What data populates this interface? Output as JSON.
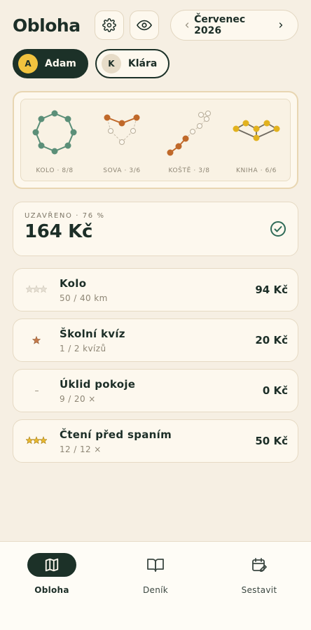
{
  "app": {
    "title": "Obloha"
  },
  "header": {
    "month": "Červenec 2026"
  },
  "users": [
    {
      "initial": "A",
      "name": "Adam",
      "active": true
    },
    {
      "initial": "K",
      "name": "Klára",
      "active": false
    }
  ],
  "constellations": [
    {
      "label": "KOLO · 8/8",
      "color": "#5b8f78"
    },
    {
      "label": "SOVA · 3/6",
      "color": "#c0692a"
    },
    {
      "label": "KOŠTĚ · 3/8",
      "color": "#c0692a"
    },
    {
      "label": "KNIHA · 6/6",
      "color": "#e2b21f"
    }
  ],
  "summary": {
    "label": "UZAVŘENO · 76 %",
    "value": "164 Kč"
  },
  "goals": [
    {
      "name": "Kolo",
      "progress": "50 / 40 km",
      "amount": "94 Kč",
      "stars": 3,
      "star_style": "faded"
    },
    {
      "name": "Školní kvíz",
      "progress": "1 / 2 kvízů",
      "amount": "20 Kč",
      "stars": 1,
      "star_style": "bronze"
    },
    {
      "name": "Úklid pokoje",
      "progress": "9 / 20 ×",
      "amount": "0 Kč",
      "stars": 0,
      "star_style": "none"
    },
    {
      "name": "Čtení před spaním",
      "progress": "12 / 12 ×",
      "amount": "50 Kč",
      "stars": 3,
      "star_style": "gold"
    }
  ],
  "nav": [
    {
      "label": "Obloha",
      "icon": "map-icon",
      "active": true
    },
    {
      "label": "Deník",
      "icon": "book-icon",
      "active": false
    },
    {
      "label": "Sestavit",
      "icon": "calendar-edit-icon",
      "active": false
    }
  ],
  "colors": {
    "background": "#f6efe3",
    "primary_dark": "#1c3128",
    "accent_yellow": "#f1c33f",
    "check_green": "#2f6b57"
  }
}
